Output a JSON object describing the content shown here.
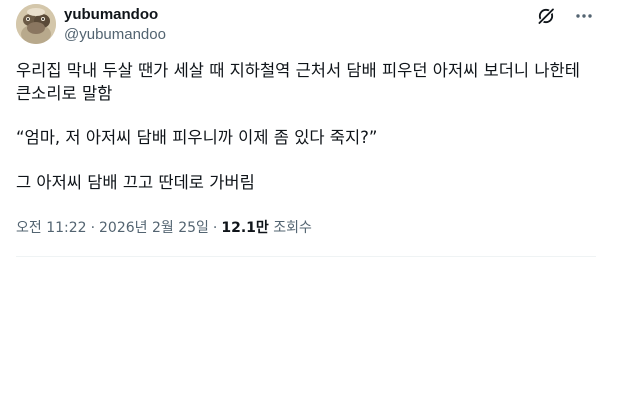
{
  "author": {
    "display_name": "yubumandoo",
    "handle": "@yubumandoo"
  },
  "icons": {
    "avatar": "avatar",
    "grok": "grok-icon",
    "more": "more-icon"
  },
  "tweet": {
    "paragraphs": [
      "우리집 막내 두살 땐가 세살 때 지하철역 근처서 담배 피우던 아저씨 보더니 나한테\n큰소리로 말함",
      "“엄마, 저 아저씨 담배 피우니까 이제 좀 있다 죽지?”",
      "그 아저씨 담배 끄고 딴데로 가버림"
    ]
  },
  "meta": {
    "time": "오전 11:22",
    "separator": "·",
    "date": "2026년 2월 25일",
    "views_count": "12.1만",
    "views_label": "조회수"
  },
  "colors": {
    "text": "#0f1419",
    "secondary": "#536471",
    "divider": "#eff3f4"
  }
}
